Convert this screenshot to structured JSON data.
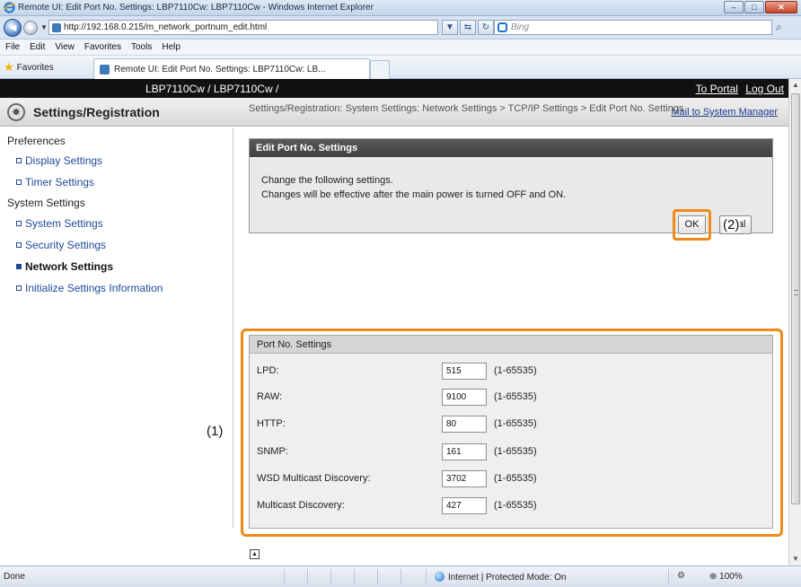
{
  "window": {
    "title": "Remote UI: Edit Port No. Settings: LBP7110Cw: LBP7110Cw - Windows Internet Explorer",
    "min_glyph": "–",
    "max_glyph": "□",
    "close_glyph": "✕"
  },
  "browser": {
    "back_glyph": "◄",
    "forward_glyph": "►",
    "dropdown_glyph": "▼",
    "url": "http://192.168.0.215/m_network_portnum_edit.html",
    "refresh_glyph": "↻",
    "compat_glyph": "⇆",
    "stop_glyph": "✕",
    "search_placeholder": "Bing",
    "search_go_glyph": "⌕",
    "menu": [
      "File",
      "Edit",
      "View",
      "Favorites",
      "Tools",
      "Help"
    ],
    "favorites_label": "Favorites",
    "favorites_icon_glyph": "★",
    "tab_label": "Remote UI: Edit Port No. Settings: LBP7110Cw: LB..."
  },
  "topbar": {
    "device": "LBP7110Cw / LBP7110Cw /",
    "to_portal": "To Portal",
    "logout": "Log Out"
  },
  "header": {
    "logo_glyph": "✸",
    "title": "Settings/Registration",
    "mail": "Mail to System Manager"
  },
  "sidebar": {
    "preferences": "Preferences",
    "display_settings": "Display Settings",
    "timer_settings": "Timer Settings",
    "system_settings_heading": "System Settings",
    "system_settings": "System Settings",
    "security_settings": "Security Settings",
    "network_settings": "Network Settings",
    "initialize": "Initialize Settings Information"
  },
  "breadcrumb": "Settings/Registration: System Settings: Network Settings > TCP/IP Settings > Edit Port No. Settings",
  "edit_panel": {
    "title": "Edit Port No. Settings",
    "line1": "Change the following settings.",
    "line2": "Changes will be effective after the main power is turned OFF and ON.",
    "ok": "OK",
    "cancel_visible": "al"
  },
  "callouts": {
    "one": "(1)",
    "two": "(2)"
  },
  "ports": {
    "title": "Port No. Settings",
    "rows": [
      {
        "label": "LPD:",
        "value": "515",
        "range": "(1-65535)"
      },
      {
        "label": "RAW:",
        "value": "9100",
        "range": "(1-65535)"
      },
      {
        "label": "HTTP:",
        "value": "80",
        "range": "(1-65535)"
      },
      {
        "label": "SNMP:",
        "value": "161",
        "range": "(1-65535)"
      },
      {
        "label": "WSD Multicast Discovery:",
        "value": "3702",
        "range": "(1-65535)"
      },
      {
        "label": "Multicast Discovery:",
        "value": "427",
        "range": "(1-65535)"
      }
    ]
  },
  "to_top_glyph": "▲",
  "status": {
    "done": "Done",
    "zone": "Internet | Protected Mode: On",
    "security_glyph": "⚙",
    "zoom": "⊕ 100%"
  },
  "colors": {
    "highlight": "#ef8a1a",
    "dark_header": "#111111",
    "link": "#1e4a9a"
  }
}
